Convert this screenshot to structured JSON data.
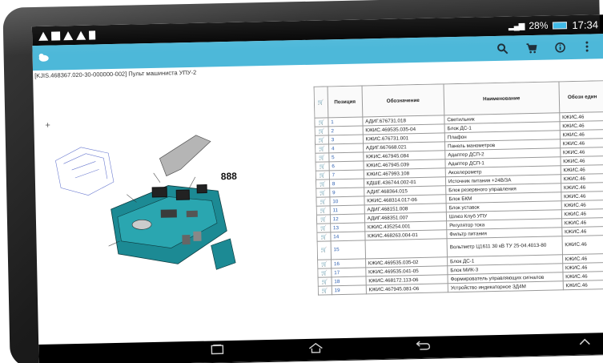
{
  "status_bar": {
    "time": "17:34",
    "battery": "28%"
  },
  "action_bar": {
    "icons": [
      "search-icon",
      "cart-icon",
      "info-icon",
      "overflow-menu-icon"
    ]
  },
  "document": {
    "title": "[KJIS.468367.020-30-000000-002] Пульт машиниста УПУ-2"
  },
  "table": {
    "headers": {
      "position": "Позиция",
      "designation": "Обозначение",
      "name": "Наименование",
      "last": "Обозн един"
    },
    "rows": [
      {
        "pos": "1",
        "des": "АДИГ.676731.018",
        "name": "Светильник",
        "last": "КЖИС.46"
      },
      {
        "pos": "2",
        "des": "КЖИС.469535.035-04",
        "name": "Блок ДС-1",
        "last": "КЖИС.46"
      },
      {
        "pos": "3",
        "des": "КЖИС.676731.001",
        "name": "Плафон",
        "last": "КЖИС.46"
      },
      {
        "pos": "4",
        "des": "АДИГ.667668.021",
        "name": "Панель манометров",
        "last": "КЖИС.46"
      },
      {
        "pos": "5",
        "des": "КЖИС.467945.084",
        "name": "Адаптер ДСП-2",
        "last": "КЖИС.46"
      },
      {
        "pos": "6",
        "des": "КЖИС.467945.039",
        "name": "Адаптер ДСП-1",
        "last": "КЖИС.46"
      },
      {
        "pos": "7",
        "des": "КЖИС.467993.108",
        "name": "Акселерометр",
        "last": "КЖИС.46"
      },
      {
        "pos": "8",
        "des": "КДШЕ.436744.002-01",
        "name": "Источник питания +24В/3А",
        "last": "КЖИС.46"
      },
      {
        "pos": "9",
        "des": "АДИГ.468364.015",
        "name": "Блок резервного управления",
        "last": "КЖИС.46"
      },
      {
        "pos": "10",
        "des": "КЖИС.468314.017-06",
        "name": "Блок БКМ",
        "last": "КЖИС.46"
      },
      {
        "pos": "11",
        "des": "АДИГ.468151.008",
        "name": "Блок уставок",
        "last": "КЖИС.46"
      },
      {
        "pos": "12",
        "des": "АДИГ.468351.007",
        "name": "Шлюз Клуб УПУ",
        "last": "КЖИС.46"
      },
      {
        "pos": "13",
        "des": "КЖИС.435254.001",
        "name": "Регулятор тока",
        "last": "КЖИС.46"
      },
      {
        "pos": "14",
        "des": "КЖИС.468263.004-01",
        "name": "Фильтр питания",
        "last": "КЖИС.46"
      },
      {
        "pos": "15",
        "des": "",
        "name": "Вольтметр Ц1611 30 кВ ТУ 25-04.4013-80",
        "last": "КЖИС.46"
      },
      {
        "pos": "16",
        "des": "КЖИС.469535.035-02",
        "name": "Блок ДС-1",
        "last": "КЖИС.46"
      },
      {
        "pos": "17",
        "des": "КЖИС.469535.041-05",
        "name": "Блок МИК-3",
        "last": "КЖИС.46"
      },
      {
        "pos": "18",
        "des": "КЖИС.468172.113-06",
        "name": "Формирователь управляющих сигналов",
        "last": "КЖИС.46"
      },
      {
        "pos": "19",
        "des": "КЖИС.467945.081-06",
        "name": "Устройство индикаторное ЗД4М",
        "last": "КЖИС.46"
      }
    ]
  },
  "drawing": {
    "zoom_label": "+",
    "callout": "888"
  },
  "nav_bar": {
    "icons": [
      "recent-apps-icon",
      "home-icon",
      "back-icon",
      "up-chevron-icon"
    ]
  },
  "colors": {
    "action_bar": "#4db8d9",
    "console": "#1c8a94",
    "link": "#2a5db0"
  }
}
